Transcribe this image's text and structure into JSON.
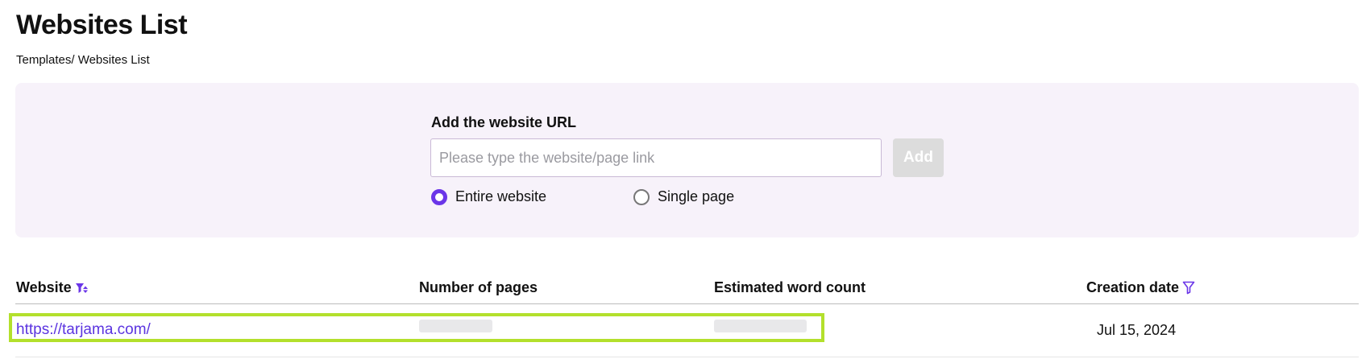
{
  "page": {
    "title": "Websites List",
    "breadcrumb": "Templates/ Websites List"
  },
  "add_form": {
    "label": "Add the website URL",
    "url_placeholder": "Please type the website/page link",
    "url_value": "",
    "add_button_label": "Add",
    "scope_options": [
      {
        "label": "Entire website",
        "selected": true
      },
      {
        "label": "Single page",
        "selected": false
      }
    ]
  },
  "table": {
    "columns": {
      "website": "Website",
      "pages": "Number of pages",
      "words": "Estimated word count",
      "created": "Creation date"
    },
    "rows": [
      {
        "website": "https://tarjama.com/",
        "pages_loading": true,
        "words_loading": true,
        "created": "Jul 15, 2024"
      }
    ]
  },
  "colors": {
    "accent": "#6a35e8",
    "link": "#5b34e0",
    "panel_bg": "#f7f2fa",
    "highlight": "#b3e02c",
    "button_disabled": "#dcdcdc"
  },
  "icons": {
    "website_sort": "sort-filter-icon",
    "creation_date_filter": "filter-icon"
  }
}
